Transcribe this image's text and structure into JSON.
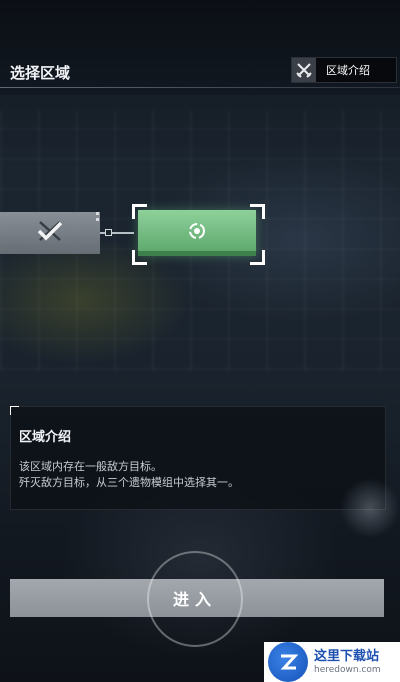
{
  "header": {
    "title": "选择区域",
    "intro_button_label": "区域介绍"
  },
  "map": {
    "nodes": [
      {
        "state": "completed",
        "icon": "crossed-swords-check-icon"
      },
      {
        "state": "current",
        "icon": "target-icon"
      }
    ]
  },
  "panel": {
    "title": "区域介绍",
    "desc_line1": "该区域内存在一般敌方目标。",
    "desc_line2": "歼灭敌方目标，从三个遗物模组中选择其一。"
  },
  "enter_button": {
    "label": "进入"
  },
  "watermark": {
    "name": "这里下载站",
    "url": "heredown.com"
  },
  "colors": {
    "accent_green": "#7cc98a",
    "background": "#121821"
  }
}
